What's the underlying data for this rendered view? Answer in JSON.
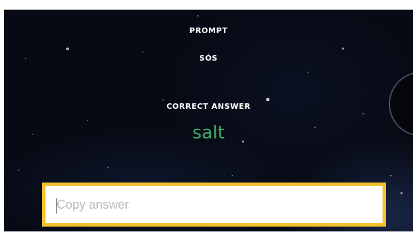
{
  "prompt": {
    "heading": "PROMPT",
    "word": "SÓS"
  },
  "correct_answer": {
    "heading": "CORRECT ANSWER",
    "word": "salt",
    "color": "#3fae66"
  },
  "answer_input": {
    "value": "",
    "placeholder": "Copy answer",
    "border_color": "#f2c12e"
  }
}
